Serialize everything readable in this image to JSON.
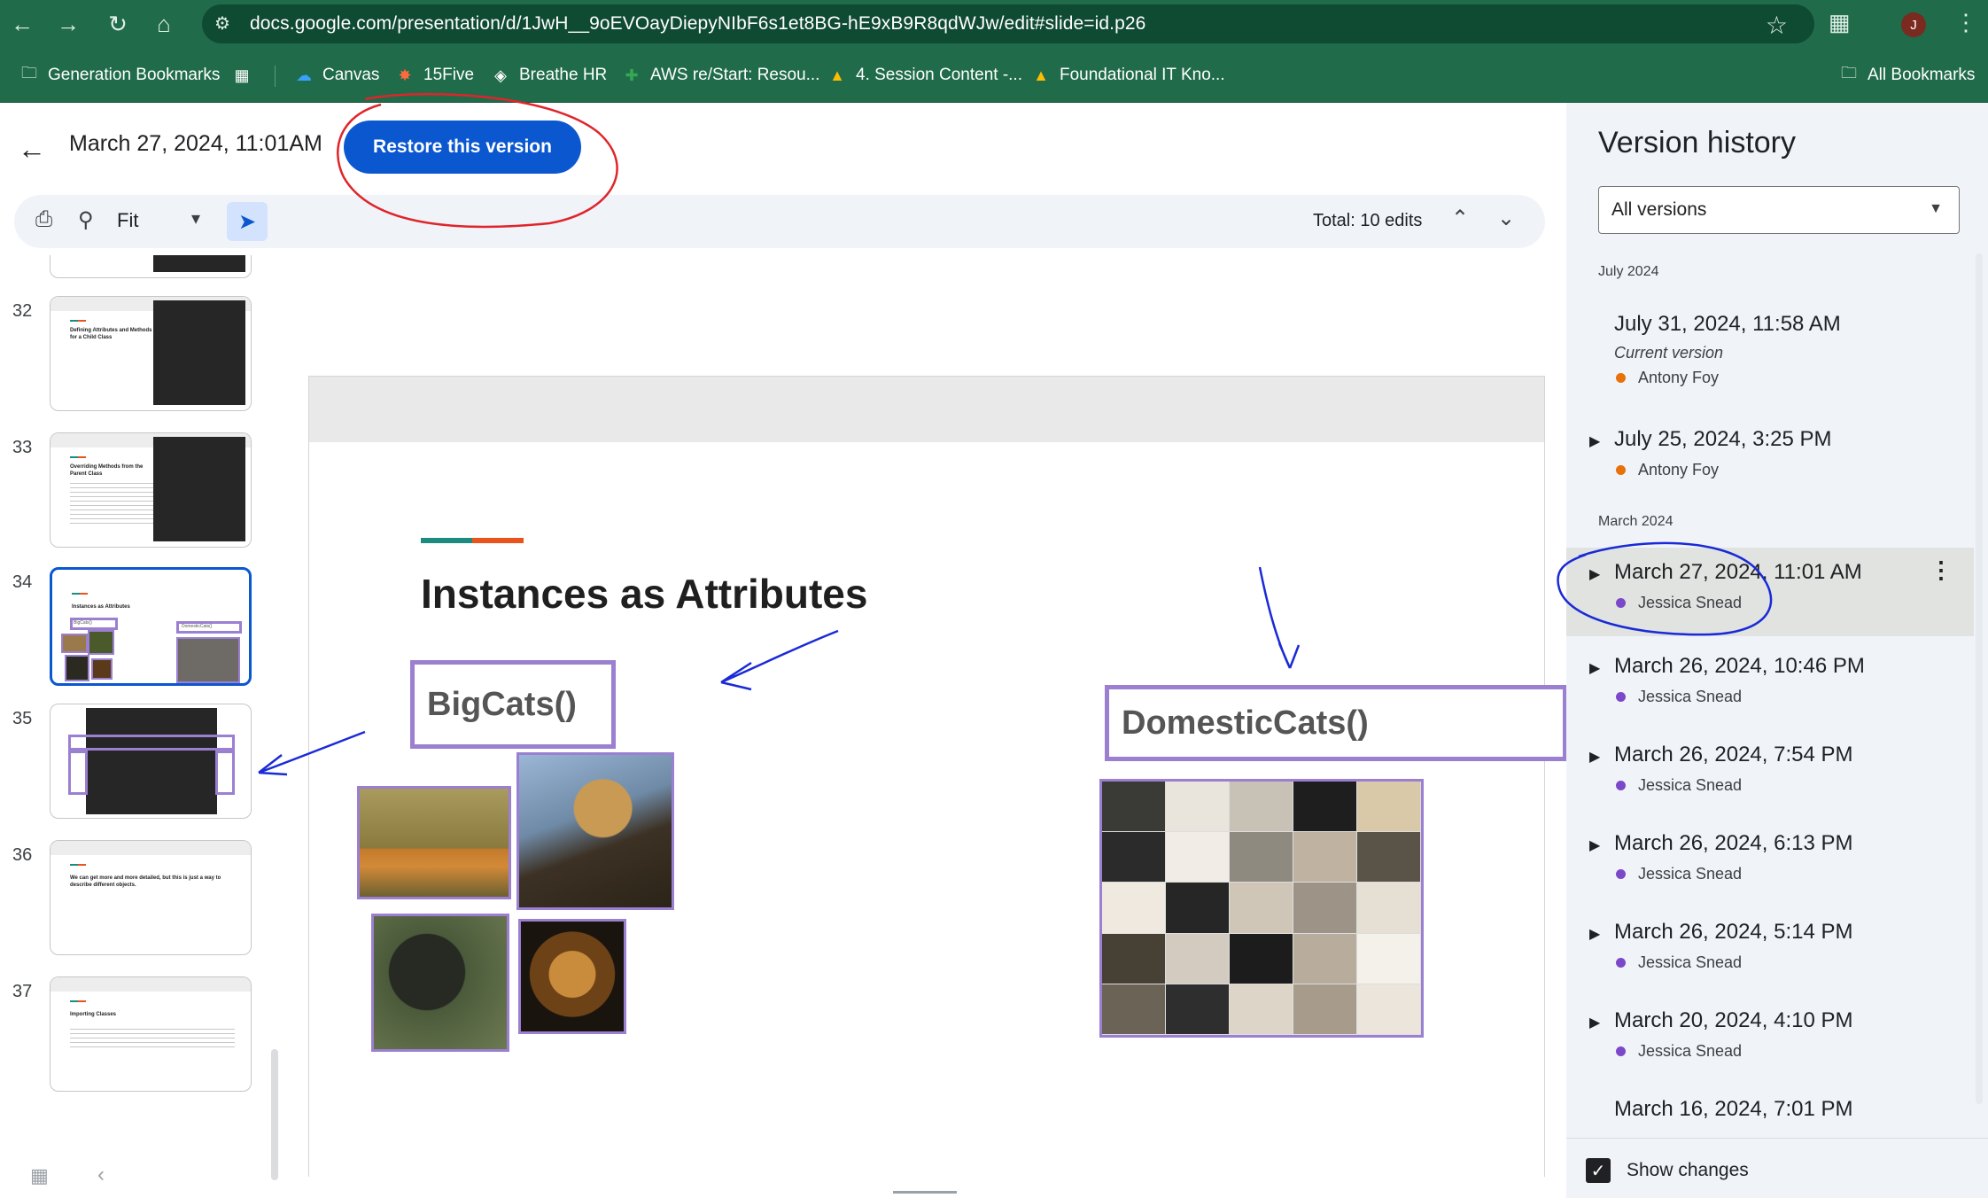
{
  "browser": {
    "url": "docs.google.com/presentation/d/1JwH__9oEVOayDiepyNIbF6s1et8BG-hE9xB9R8qdWJw/edit#slide=id.p26",
    "profile_initial": "J",
    "bookmarks": [
      {
        "label": "Generation Bookmarks",
        "icon": "folder-icon"
      },
      {
        "label": "Canvas",
        "icon": "canvas-icon"
      },
      {
        "label": "15Five",
        "icon": "15five-icon"
      },
      {
        "label": "Breathe HR",
        "icon": "breathe-icon"
      },
      {
        "label": "AWS re/Start: Resou...",
        "icon": "sheets-icon"
      },
      {
        "label": "4. Session Content -...",
        "icon": "drive-icon"
      },
      {
        "label": "Foundational IT Kno...",
        "icon": "drive-icon"
      }
    ],
    "all_bookmarks": "All Bookmarks"
  },
  "editor": {
    "version_title": "March 27, 2024, 11:01AM",
    "restore_label": "Restore this version",
    "zoom": "Fit",
    "total_edits": "Total: 10 edits"
  },
  "filmstrip": {
    "numbers": [
      "32",
      "33",
      "34",
      "35",
      "36",
      "37"
    ],
    "thumb_titles": {
      "t32": "Defining Attributes and Methods for a Child Class",
      "t33": "Overriding Methods from the Parent Class",
      "t34": "Instances as Attributes",
      "t34_box_a": "BigCats()",
      "t34_box_b": "DomesticCats()",
      "t36": "We can get more and more detailed, but this is just a way to describe different objects.",
      "t37": "Importing Classes"
    }
  },
  "slide": {
    "title": "Instances as Attributes",
    "box_left": "BigCats()",
    "box_right": "DomesticCats()"
  },
  "version_history": {
    "title": "Version history",
    "filter": "All versions",
    "groups": {
      "july": "July 2024",
      "march": "March 2024"
    },
    "current_label": "Current version",
    "items": [
      {
        "date": "July 31, 2024, 11:58 AM",
        "author": "Antony Foy",
        "color": "#e8710a"
      },
      {
        "date": "July 25, 2024, 3:25 PM",
        "author": "Antony Foy",
        "color": "#e8710a"
      },
      {
        "date": "March 27, 2024, 11:01 AM",
        "author": "Jessica Snead",
        "color": "#7b48c9"
      },
      {
        "date": "March 26, 2024, 10:46 PM",
        "author": "Jessica Snead",
        "color": "#7b48c9"
      },
      {
        "date": "March 26, 2024, 7:54 PM",
        "author": "Jessica Snead",
        "color": "#7b48c9"
      },
      {
        "date": "March 26, 2024, 6:13 PM",
        "author": "Jessica Snead",
        "color": "#7b48c9"
      },
      {
        "date": "March 26, 2024, 5:14 PM",
        "author": "Jessica Snead",
        "color": "#7b48c9"
      },
      {
        "date": "March 20, 2024, 4:10 PM",
        "author": "Jessica Snead",
        "color": "#7b48c9"
      },
      {
        "date": "March 16, 2024, 7:01 PM",
        "author": "",
        "color": "#7b48c9"
      }
    ],
    "show_changes": "Show changes"
  },
  "colors": {
    "chrome": "#1f6b4a",
    "primary": "#0b57d0",
    "panel": "#f0f4f9",
    "purple_box": "#9b7fd1",
    "annotation_red": "#e0242a",
    "annotation_blue": "#1a2ad6"
  }
}
